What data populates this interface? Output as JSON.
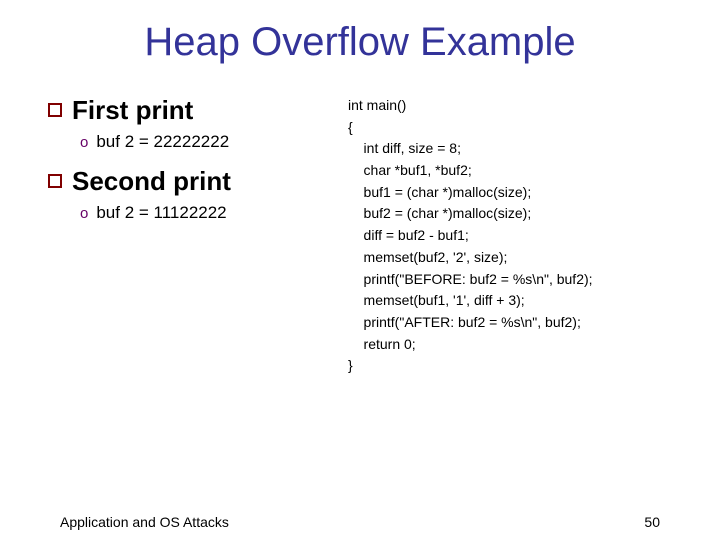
{
  "title": "Heap Overflow Example",
  "left": {
    "items": [
      {
        "heading": "First print",
        "sub": "buf 2 = 22222222"
      },
      {
        "heading": "Second print",
        "sub": "buf 2 = 11122222"
      }
    ]
  },
  "code": {
    "l1": "int main()",
    "l2": "{",
    "l3": "    int diff, size = 8;",
    "l4": "    char *buf1, *buf2;",
    "l5": "    buf1 = (char *)malloc(size);",
    "l6": "    buf2 = (char *)malloc(size);",
    "l7": "    diff = buf2 - buf1;",
    "l8": "    memset(buf2, '2', size);",
    "l9": "    printf(\"BEFORE: buf2 = %s\\n\", buf2);",
    "l10": "    memset(buf1, '1', diff + 3);",
    "l11": "    printf(\"AFTER: buf2 = %s\\n\", buf2);",
    "l12": "    return 0;",
    "l13": "}"
  },
  "footer": {
    "left": "Application and OS Attacks",
    "right": "50"
  }
}
